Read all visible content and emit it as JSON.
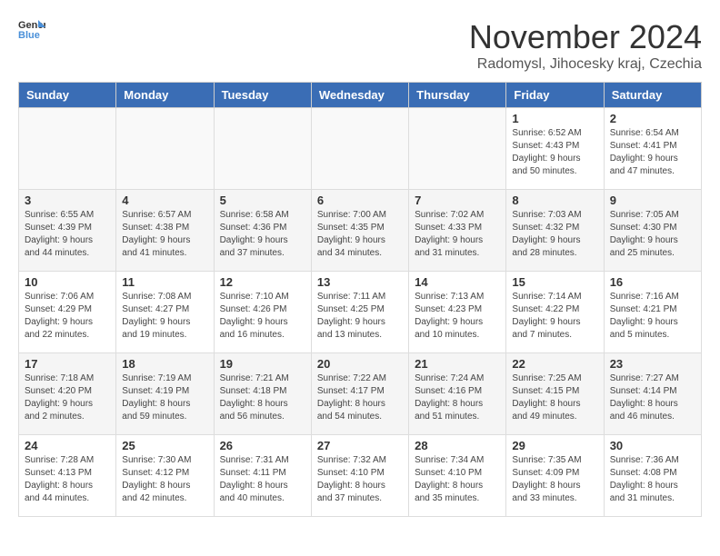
{
  "logo": {
    "line1": "General",
    "line2": "Blue"
  },
  "title": "November 2024",
  "subtitle": "Radomysl, Jihocesky kraj, Czechia",
  "days_header": [
    "Sunday",
    "Monday",
    "Tuesday",
    "Wednesday",
    "Thursday",
    "Friday",
    "Saturday"
  ],
  "weeks": [
    [
      {
        "day": "",
        "info": ""
      },
      {
        "day": "",
        "info": ""
      },
      {
        "day": "",
        "info": ""
      },
      {
        "day": "",
        "info": ""
      },
      {
        "day": "",
        "info": ""
      },
      {
        "day": "1",
        "info": "Sunrise: 6:52 AM\nSunset: 4:43 PM\nDaylight: 9 hours\nand 50 minutes."
      },
      {
        "day": "2",
        "info": "Sunrise: 6:54 AM\nSunset: 4:41 PM\nDaylight: 9 hours\nand 47 minutes."
      }
    ],
    [
      {
        "day": "3",
        "info": "Sunrise: 6:55 AM\nSunset: 4:39 PM\nDaylight: 9 hours\nand 44 minutes."
      },
      {
        "day": "4",
        "info": "Sunrise: 6:57 AM\nSunset: 4:38 PM\nDaylight: 9 hours\nand 41 minutes."
      },
      {
        "day": "5",
        "info": "Sunrise: 6:58 AM\nSunset: 4:36 PM\nDaylight: 9 hours\nand 37 minutes."
      },
      {
        "day": "6",
        "info": "Sunrise: 7:00 AM\nSunset: 4:35 PM\nDaylight: 9 hours\nand 34 minutes."
      },
      {
        "day": "7",
        "info": "Sunrise: 7:02 AM\nSunset: 4:33 PM\nDaylight: 9 hours\nand 31 minutes."
      },
      {
        "day": "8",
        "info": "Sunrise: 7:03 AM\nSunset: 4:32 PM\nDaylight: 9 hours\nand 28 minutes."
      },
      {
        "day": "9",
        "info": "Sunrise: 7:05 AM\nSunset: 4:30 PM\nDaylight: 9 hours\nand 25 minutes."
      }
    ],
    [
      {
        "day": "10",
        "info": "Sunrise: 7:06 AM\nSunset: 4:29 PM\nDaylight: 9 hours\nand 22 minutes."
      },
      {
        "day": "11",
        "info": "Sunrise: 7:08 AM\nSunset: 4:27 PM\nDaylight: 9 hours\nand 19 minutes."
      },
      {
        "day": "12",
        "info": "Sunrise: 7:10 AM\nSunset: 4:26 PM\nDaylight: 9 hours\nand 16 minutes."
      },
      {
        "day": "13",
        "info": "Sunrise: 7:11 AM\nSunset: 4:25 PM\nDaylight: 9 hours\nand 13 minutes."
      },
      {
        "day": "14",
        "info": "Sunrise: 7:13 AM\nSunset: 4:23 PM\nDaylight: 9 hours\nand 10 minutes."
      },
      {
        "day": "15",
        "info": "Sunrise: 7:14 AM\nSunset: 4:22 PM\nDaylight: 9 hours\nand 7 minutes."
      },
      {
        "day": "16",
        "info": "Sunrise: 7:16 AM\nSunset: 4:21 PM\nDaylight: 9 hours\nand 5 minutes."
      }
    ],
    [
      {
        "day": "17",
        "info": "Sunrise: 7:18 AM\nSunset: 4:20 PM\nDaylight: 9 hours\nand 2 minutes."
      },
      {
        "day": "18",
        "info": "Sunrise: 7:19 AM\nSunset: 4:19 PM\nDaylight: 8 hours\nand 59 minutes."
      },
      {
        "day": "19",
        "info": "Sunrise: 7:21 AM\nSunset: 4:18 PM\nDaylight: 8 hours\nand 56 minutes."
      },
      {
        "day": "20",
        "info": "Sunrise: 7:22 AM\nSunset: 4:17 PM\nDaylight: 8 hours\nand 54 minutes."
      },
      {
        "day": "21",
        "info": "Sunrise: 7:24 AM\nSunset: 4:16 PM\nDaylight: 8 hours\nand 51 minutes."
      },
      {
        "day": "22",
        "info": "Sunrise: 7:25 AM\nSunset: 4:15 PM\nDaylight: 8 hours\nand 49 minutes."
      },
      {
        "day": "23",
        "info": "Sunrise: 7:27 AM\nSunset: 4:14 PM\nDaylight: 8 hours\nand 46 minutes."
      }
    ],
    [
      {
        "day": "24",
        "info": "Sunrise: 7:28 AM\nSunset: 4:13 PM\nDaylight: 8 hours\nand 44 minutes."
      },
      {
        "day": "25",
        "info": "Sunrise: 7:30 AM\nSunset: 4:12 PM\nDaylight: 8 hours\nand 42 minutes."
      },
      {
        "day": "26",
        "info": "Sunrise: 7:31 AM\nSunset: 4:11 PM\nDaylight: 8 hours\nand 40 minutes."
      },
      {
        "day": "27",
        "info": "Sunrise: 7:32 AM\nSunset: 4:10 PM\nDaylight: 8 hours\nand 37 minutes."
      },
      {
        "day": "28",
        "info": "Sunrise: 7:34 AM\nSunset: 4:10 PM\nDaylight: 8 hours\nand 35 minutes."
      },
      {
        "day": "29",
        "info": "Sunrise: 7:35 AM\nSunset: 4:09 PM\nDaylight: 8 hours\nand 33 minutes."
      },
      {
        "day": "30",
        "info": "Sunrise: 7:36 AM\nSunset: 4:08 PM\nDaylight: 8 hours\nand 31 minutes."
      }
    ]
  ]
}
